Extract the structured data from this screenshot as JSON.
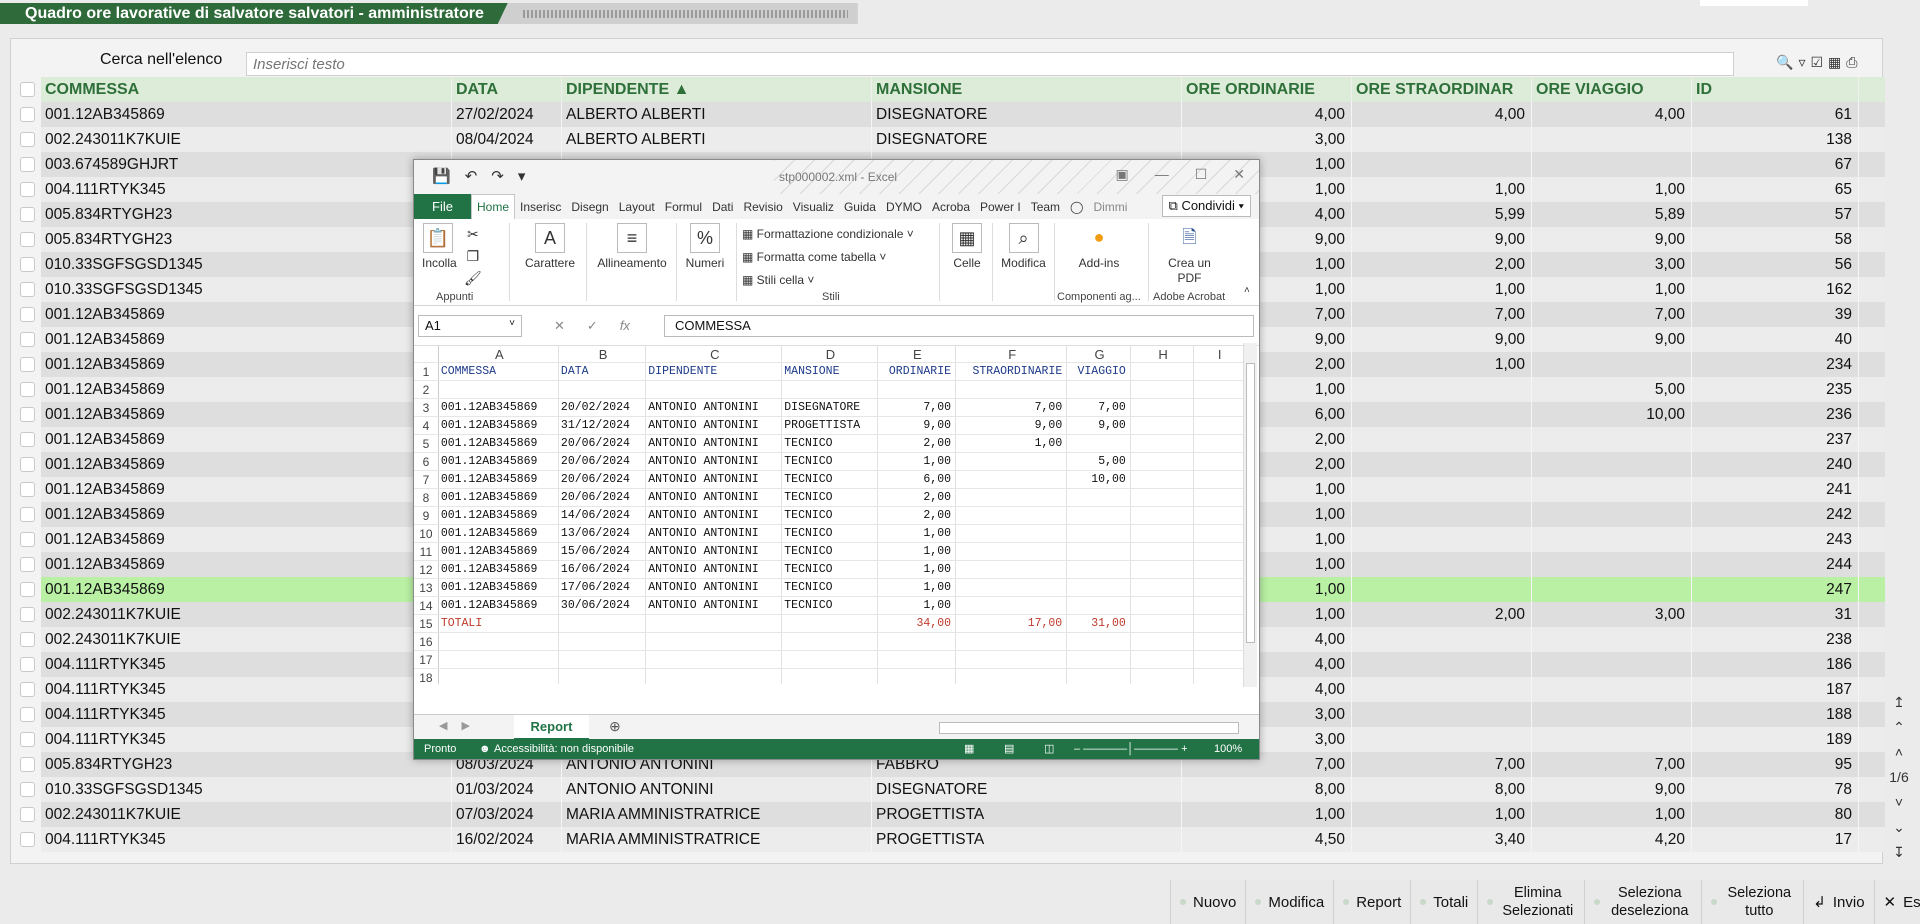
{
  "window": {
    "title": "Quadro ore lavorative di salvatore salvatori - amministratore"
  },
  "search": {
    "label": "Cerca nell'elenco",
    "placeholder": "Inserisci testo"
  },
  "grid": {
    "headers": [
      "COMMESSA",
      "DATA",
      "DIPENDENTE ▲",
      "MANSIONE",
      "ORE ORDINARIE",
      "ORE STRAORDINAR",
      "ORE VIAGGIO",
      "ID"
    ],
    "rows": [
      [
        "001.12AB345869",
        "27/02/2024",
        "ALBERTO ALBERTI",
        "DISEGNATORE",
        "4,00",
        "4,00",
        "4,00",
        "61"
      ],
      [
        "002.243011K7KUIE",
        "08/04/2024",
        "ALBERTO ALBERTI",
        "DISEGNATORE",
        "3,00",
        "",
        "",
        "138"
      ],
      [
        "003.674589GHJRT",
        "",
        "",
        "",
        "1,00",
        "",
        "",
        "67"
      ],
      [
        "004.111RTYK345",
        "",
        "",
        "",
        "1,00",
        "1,00",
        "1,00",
        "65"
      ],
      [
        "005.834RTYGH23",
        "",
        "",
        "",
        "4,00",
        "5,99",
        "5,89",
        "57"
      ],
      [
        "005.834RTYGH23",
        "",
        "",
        "",
        "9,00",
        "9,00",
        "9,00",
        "58"
      ],
      [
        "010.33SGFSGSD1345",
        "",
        "",
        "",
        "1,00",
        "2,00",
        "3,00",
        "56"
      ],
      [
        "010.33SGFSGSD1345",
        "",
        "",
        "",
        "1,00",
        "1,00",
        "1,00",
        "162"
      ],
      [
        "001.12AB345869",
        "",
        "",
        "",
        "7,00",
        "7,00",
        "7,00",
        "39"
      ],
      [
        "001.12AB345869",
        "",
        "",
        "",
        "9,00",
        "9,00",
        "9,00",
        "40"
      ],
      [
        "001.12AB345869",
        "",
        "",
        "",
        "2,00",
        "1,00",
        "",
        "234"
      ],
      [
        "001.12AB345869",
        "",
        "",
        "",
        "1,00",
        "",
        "5,00",
        "235"
      ],
      [
        "001.12AB345869",
        "",
        "",
        "",
        "6,00",
        "",
        "10,00",
        "236"
      ],
      [
        "001.12AB345869",
        "",
        "",
        "",
        "2,00",
        "",
        "",
        "237"
      ],
      [
        "001.12AB345869",
        "",
        "",
        "",
        "2,00",
        "",
        "",
        "240"
      ],
      [
        "001.12AB345869",
        "",
        "",
        "",
        "1,00",
        "",
        "",
        "241"
      ],
      [
        "001.12AB345869",
        "",
        "",
        "",
        "1,00",
        "",
        "",
        "242"
      ],
      [
        "001.12AB345869",
        "",
        "",
        "",
        "1,00",
        "",
        "",
        "243"
      ],
      [
        "001.12AB345869",
        "",
        "",
        "",
        "1,00",
        "",
        "",
        "244"
      ],
      [
        "001.12AB345869",
        "",
        "",
        "",
        "1,00",
        "",
        "",
        "247"
      ],
      [
        "002.243011K7KUIE",
        "",
        "",
        "",
        "1,00",
        "2,00",
        "3,00",
        "31"
      ],
      [
        "002.243011K7KUIE",
        "",
        "",
        "",
        "4,00",
        "",
        "",
        "238"
      ],
      [
        "004.111RTYK345",
        "",
        "",
        "",
        "4,00",
        "",
        "",
        "186"
      ],
      [
        "004.111RTYK345",
        "",
        "",
        "",
        "4,00",
        "",
        "",
        "187"
      ],
      [
        "004.111RTYK345",
        "",
        "",
        "",
        "3,00",
        "",
        "",
        "188"
      ],
      [
        "004.111RTYK345",
        "",
        "",
        "",
        "3,00",
        "",
        "",
        "189"
      ],
      [
        "005.834RTYGH23",
        "08/03/2024",
        "ANTONIO ANTONINI",
        "FABBRO",
        "7,00",
        "7,00",
        "7,00",
        "95"
      ],
      [
        "010.33SGFSGSD1345",
        "01/03/2024",
        "ANTONIO ANTONINI",
        "DISEGNATORE",
        "8,00",
        "8,00",
        "9,00",
        "78"
      ],
      [
        "002.243011K7KUIE",
        "07/03/2024",
        "MARIA AMMINISTRATRICE",
        "PROGETTISTA",
        "1,00",
        "1,00",
        "1,00",
        "80"
      ],
      [
        "004.111RTYK345",
        "16/02/2024",
        "MARIA AMMINISTRATRICE",
        "PROGETTISTA",
        "4,50",
        "3,40",
        "4,20",
        "17"
      ]
    ],
    "selected_row": 19
  },
  "pager": {
    "page": "1/6"
  },
  "bottom_buttons": [
    "Nuovo",
    "Modifica",
    "Report",
    "Totali",
    "Elimina Selezionati",
    "Seleziona deseleziona",
    "Seleziona tutto",
    "Invio",
    "Esc"
  ],
  "excel": {
    "filename": "stp000002.xml - Excel",
    "tabs": [
      "File",
      "Home",
      "Inserisc",
      "Disegn",
      "Layout",
      "Formul",
      "Dati",
      "Revisio",
      "Visualiz",
      "Guida",
      "DYMO",
      "Acroba",
      "Power I",
      "Team",
      "Dimmi"
    ],
    "share": "Condividi",
    "ribbon": {
      "incolla": "Incolla",
      "appunti": "Appunti",
      "carattere": "Carattere",
      "allineamento": "Allineamento",
      "numeri": "Numeri",
      "formattazione_condizionale": "Formattazione condizionale",
      "formatta_tabella": "Formatta come tabella",
      "stili_cella": "Stili cella",
      "stili": "Stili",
      "celle": "Celle",
      "modifica": "Modifica",
      "addins": "Add-ins",
      "componenti": "Componenti ag...",
      "crea_pdf": "Crea un PDF",
      "adobe": "Adobe Acrobat"
    },
    "namebox": "A1",
    "formula": "COMMESSA",
    "col_letters": [
      "A",
      "B",
      "C",
      "D",
      "E",
      "F",
      "G",
      "H",
      "I"
    ],
    "rows": [
      [
        "COMMESSA",
        "DATA",
        "DIPENDENTE",
        "MANSIONE",
        "ORDINARIE",
        "STRAORDINARIE",
        "VIAGGIO",
        "",
        ""
      ],
      [
        "",
        "",
        "",
        "",
        "",
        "",
        "",
        "",
        ""
      ],
      [
        "001.12AB345869",
        "20/02/2024",
        "ANTONIO ANTONINI",
        "DISEGNATORE",
        "7,00",
        "7,00",
        "7,00",
        "",
        ""
      ],
      [
        "001.12AB345869",
        "31/12/2024",
        "ANTONIO ANTONINI",
        "PROGETTISTA",
        "9,00",
        "9,00",
        "9,00",
        "",
        ""
      ],
      [
        "001.12AB345869",
        "20/06/2024",
        "ANTONIO ANTONINI",
        "TECNICO",
        "2,00",
        "1,00",
        "",
        "",
        ""
      ],
      [
        "001.12AB345869",
        "20/06/2024",
        "ANTONIO ANTONINI",
        "TECNICO",
        "1,00",
        "",
        "5,00",
        "",
        ""
      ],
      [
        "001.12AB345869",
        "20/06/2024",
        "ANTONIO ANTONINI",
        "TECNICO",
        "6,00",
        "",
        "10,00",
        "",
        ""
      ],
      [
        "001.12AB345869",
        "20/06/2024",
        "ANTONIO ANTONINI",
        "TECNICO",
        "2,00",
        "",
        "",
        "",
        ""
      ],
      [
        "001.12AB345869",
        "14/06/2024",
        "ANTONIO ANTONINI",
        "TECNICO",
        "2,00",
        "",
        "",
        "",
        ""
      ],
      [
        "001.12AB345869",
        "13/06/2024",
        "ANTONIO ANTONINI",
        "TECNICO",
        "1,00",
        "",
        "",
        "",
        ""
      ],
      [
        "001.12AB345869",
        "15/06/2024",
        "ANTONIO ANTONINI",
        "TECNICO",
        "1,00",
        "",
        "",
        "",
        ""
      ],
      [
        "001.12AB345869",
        "16/06/2024",
        "ANTONIO ANTONINI",
        "TECNICO",
        "1,00",
        "",
        "",
        "",
        ""
      ],
      [
        "001.12AB345869",
        "17/06/2024",
        "ANTONIO ANTONINI",
        "TECNICO",
        "1,00",
        "",
        "",
        "",
        ""
      ],
      [
        "001.12AB345869",
        "30/06/2024",
        "ANTONIO ANTONINI",
        "TECNICO",
        "1,00",
        "",
        "",
        "",
        ""
      ],
      [
        "TOTALI",
        "",
        "",
        "",
        "34,00",
        "17,00",
        "31,00",
        "",
        ""
      ],
      [
        "",
        "",
        "",
        "",
        "",
        "",
        "",
        "",
        ""
      ],
      [
        "",
        "",
        "",
        "",
        "",
        "",
        "",
        "",
        ""
      ],
      [
        "",
        "",
        "",
        "",
        "",
        "",
        "",
        "",
        ""
      ],
      [
        "",
        "",
        "",
        "",
        "",
        "",
        "",
        "",
        ""
      ]
    ],
    "sheet_tab": "Report",
    "status_ready": "Pronto",
    "status_access": "Accessibilità: non disponibile",
    "zoom": "100%"
  }
}
